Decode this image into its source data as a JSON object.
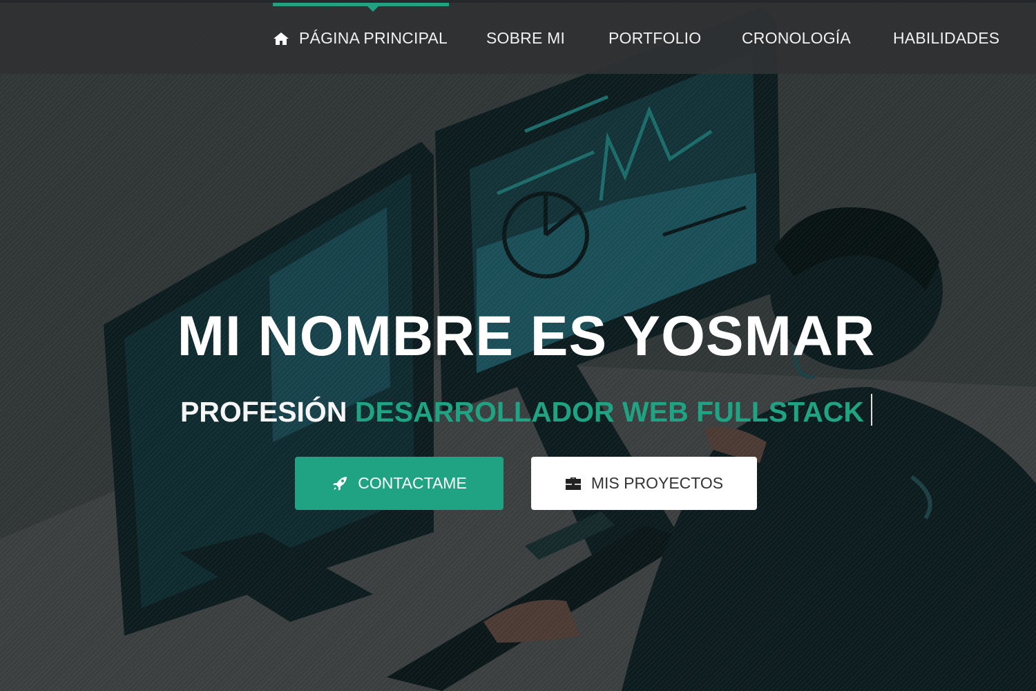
{
  "nav": {
    "items": [
      {
        "label": "PÁGINA PRINCIPAL",
        "icon": "home-icon",
        "active": true
      },
      {
        "label": "SOBRE MI"
      },
      {
        "label": "PORTFOLIO"
      },
      {
        "label": "CRONOLOGÍA"
      },
      {
        "label": "HABILIDADES"
      }
    ]
  },
  "hero": {
    "title": "MI NOMBRE ES YOSMAR",
    "subtitle_prefix": "PROFESIÓN",
    "subtitle_accent": "DESARROLLADOR WEB FULLSTACK",
    "buttons": [
      {
        "label": "CONTACTAME",
        "icon": "rocket-icon"
      },
      {
        "label": "MIS PROYECTOS",
        "icon": "briefcase-icon"
      }
    ]
  },
  "colors": {
    "accent": "#1fa383",
    "navbar": "#303233",
    "overlay": "#2a2d2e"
  }
}
